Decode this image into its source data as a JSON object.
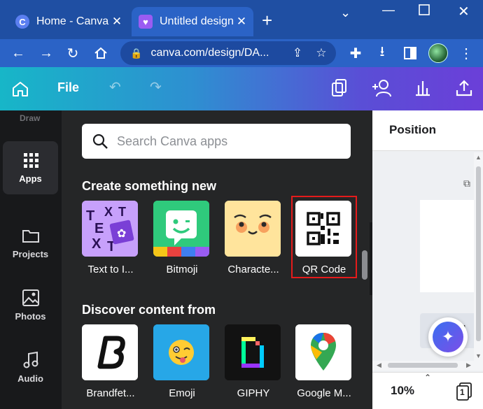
{
  "browser": {
    "tabs": [
      {
        "title": "Home - Canva",
        "close": "✕"
      },
      {
        "title": "Untitled design",
        "close": "✕"
      }
    ],
    "new_tab": "+",
    "url": "canva.com/design/DA..."
  },
  "canva_topbar": {
    "file_label": "File"
  },
  "sidebar": {
    "partial_label": "Draw",
    "items": [
      {
        "label": "Apps",
        "icon": "apps-grid-icon"
      },
      {
        "label": "Projects",
        "icon": "folder-icon"
      },
      {
        "label": "Photos",
        "icon": "image-icon"
      },
      {
        "label": "Audio",
        "icon": "music-note-icon"
      }
    ]
  },
  "apps_panel": {
    "search_placeholder": "Search Canva apps",
    "section_create": "Create something new",
    "create_apps": [
      {
        "label": "Text to I..."
      },
      {
        "label": "Bitmoji"
      },
      {
        "label": "Characte..."
      },
      {
        "label": "QR Code"
      }
    ],
    "section_discover": "Discover content from",
    "discover_apps": [
      {
        "label": "Brandfet..."
      },
      {
        "label": "Emoji"
      },
      {
        "label": "GIPHY"
      },
      {
        "label": "Google M..."
      }
    ]
  },
  "editor": {
    "position_title": "Position",
    "zoom": "10%",
    "page_count": "1",
    "partial_text": "d"
  },
  "colors": {
    "highlight": "#e51b1b",
    "browser_blue": "#2b63c6",
    "canva_gradient_start": "#17b6c8",
    "canva_gradient_end": "#6b3fd8"
  }
}
